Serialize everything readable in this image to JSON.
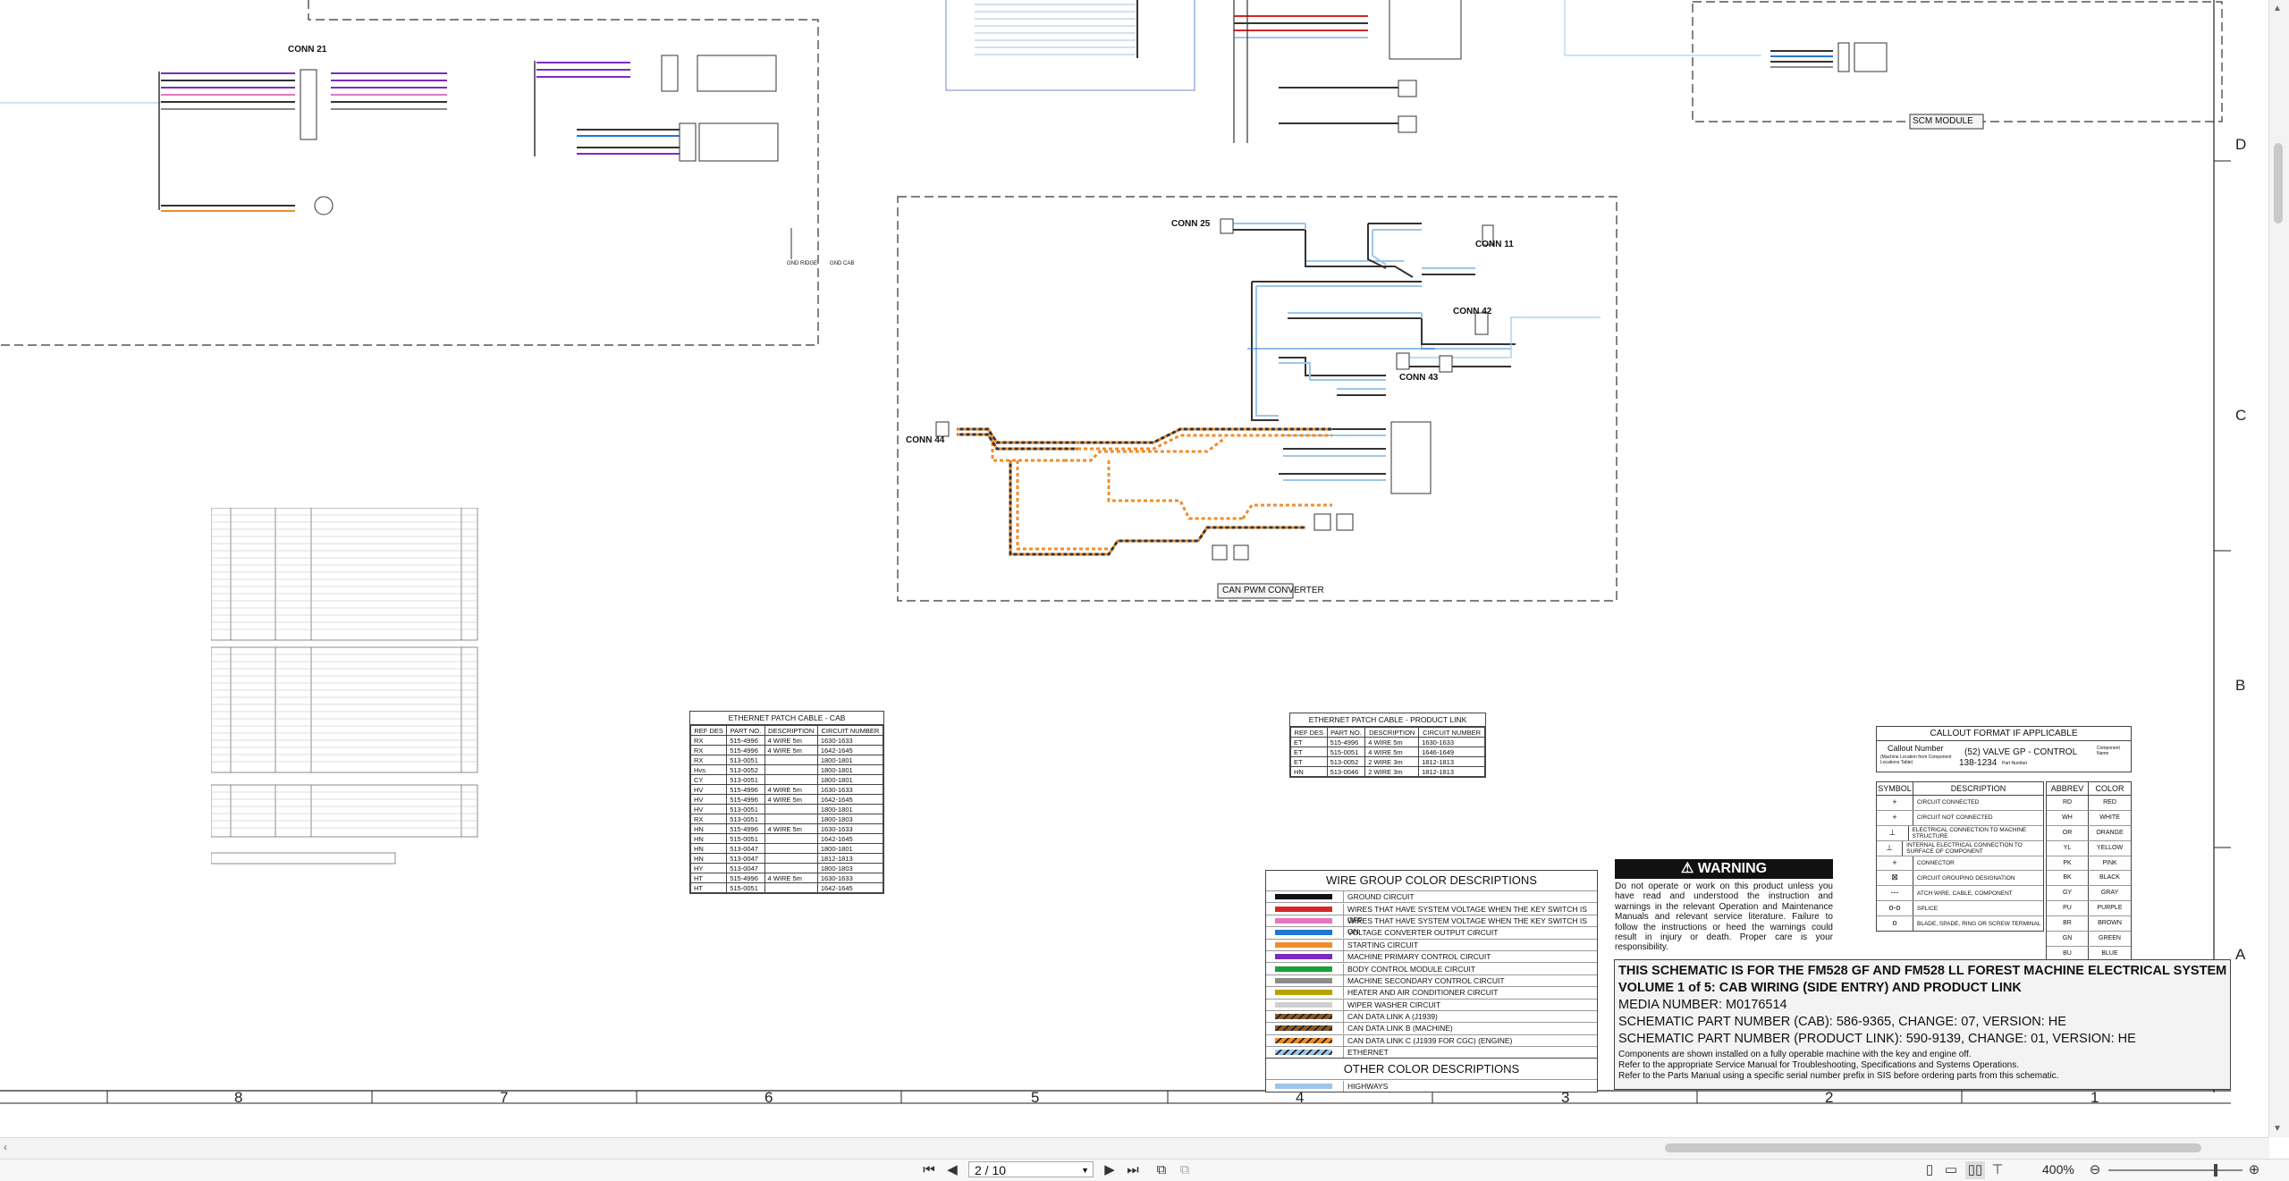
{
  "viewer": {
    "page_indicator": "2 / 10",
    "zoom": "400%"
  },
  "grid": {
    "columns": [
      "8",
      "7",
      "6",
      "5",
      "4",
      "3",
      "2",
      "1"
    ],
    "rows": [
      "D",
      "C",
      "B",
      "A"
    ]
  },
  "schematic": {
    "conn21": "CONN 21",
    "conn25": "CONN 25",
    "conn11": "CONN 11",
    "conn42": "CONN 42",
    "conn43": "CONN 43",
    "conn44": "CONN 44",
    "can_pwm_converter": "CAN PWM CONVERTER",
    "scm_module": "SCM MODULE",
    "gnd_ridge": "GND RIDGE",
    "gnd_cab": "GND CAB"
  },
  "ethernet_cab": {
    "title": "ETHERNET PATCH CABLE - CAB",
    "headers": [
      "REF DES",
      "PART NO.",
      "DESCRIPTION",
      "CIRCUIT NUMBER"
    ],
    "rows": [
      [
        "RX",
        "515-4996",
        "4 WIRE 5m",
        "1630-1633"
      ],
      [
        "RX",
        "515-4996",
        "4 WIRE 5m",
        "1642-1645"
      ],
      [
        "RX",
        "513-0051",
        "",
        "1800-1801"
      ],
      [
        "Hvs",
        "513-0052",
        "",
        "1800-1801"
      ],
      [
        "CY",
        "513-0051",
        "",
        "1800-1801"
      ],
      [
        "HV",
        "515-4996",
        "4 WIRE 5m",
        "1630-1633"
      ],
      [
        "HV",
        "515-4996",
        "4 WIRE 5m",
        "1642-1645"
      ],
      [
        "HV",
        "513-0051",
        "",
        "1800-1801"
      ],
      [
        "RX",
        "513-0051",
        "",
        "1800-1803"
      ],
      [
        "HN",
        "515-4996",
        "4 WIRE 5m",
        "1630-1633"
      ],
      [
        "HN",
        "515-0051",
        "",
        "1642-1645"
      ],
      [
        "HN",
        "513-0047",
        "",
        "1800-1801"
      ],
      [
        "HN",
        "513-0047",
        "",
        "1812-1813"
      ],
      [
        "HY",
        "513-0047",
        "",
        "1800-1803"
      ],
      [
        "HT",
        "515-4996",
        "4 WIRE 5m",
        "1630-1633"
      ],
      [
        "HT",
        "515-0051",
        "",
        "1642-1645"
      ]
    ]
  },
  "ethernet_product": {
    "title": "ETHERNET PATCH CABLE - PRODUCT LINK",
    "headers": [
      "REF DES",
      "PART NO.",
      "DESCRIPTION",
      "CIRCUIT NUMBER"
    ],
    "rows": [
      [
        "ET",
        "515-4996",
        "4 WIRE 5m",
        "1630-1633"
      ],
      [
        "ET",
        "515-0051",
        "4 WIRE 5m",
        "1646-1649"
      ],
      [
        "ET",
        "513-0052",
        "2 WIRE 3m",
        "1812-1813"
      ],
      [
        "HN",
        "513-0046",
        "2 WIRE 3m",
        "1812-1813"
      ]
    ]
  },
  "wire_groups": {
    "title": "WIRE GROUP COLOR DESCRIPTIONS",
    "items": [
      {
        "color": "#111111",
        "pattern": "solid",
        "label": "GROUND CIRCUIT"
      },
      {
        "color": "#d62728",
        "pattern": "solid",
        "label": "WIRES THAT HAVE SYSTEM VOLTAGE WHEN THE KEY SWITCH IS OFF"
      },
      {
        "color": "#e377c2",
        "pattern": "solid",
        "label": "WIRES THAT HAVE SYSTEM VOLTAGE WHEN THE KEY SWITCH IS ON"
      },
      {
        "color": "#1f77d4",
        "pattern": "solid",
        "label": "VOLTAGE CONVERTER OUTPUT CIRCUIT"
      },
      {
        "color": "#f28c28",
        "pattern": "solid",
        "label": "STARTING CIRCUIT"
      },
      {
        "color": "#7b2cbf",
        "pattern": "solid",
        "label": "MACHINE PRIMARY CONTROL CIRCUIT"
      },
      {
        "color": "#1a9e3a",
        "pattern": "solid",
        "label": "BODY CONTROL MODULE CIRCUIT"
      },
      {
        "color": "#8c8c8c",
        "pattern": "solid",
        "label": "MACHINE SECONDARY CONTROL CIRCUIT"
      },
      {
        "color": "#b5a300",
        "pattern": "solid",
        "label": "HEATER AND AIR CONDITIONER CIRCUIT"
      },
      {
        "color": "#cfcfcf",
        "pattern": "solid",
        "label": "WIPER WASHER CIRCUIT"
      },
      {
        "color": "#8a5a2b",
        "pattern": "hatch",
        "label": "CAN DATA LINK A (J1939)"
      },
      {
        "color": "#8a5a2b",
        "pattern": "hatch",
        "label": "CAN DATA LINK B (MACHINE)"
      },
      {
        "color": "#f28c28",
        "pattern": "hatch",
        "label": "CAN DATA LINK C (J1939 FOR CGC) (ENGINE)"
      },
      {
        "color": "#9ec6e8",
        "pattern": "hatch",
        "label": "ETHERNET"
      }
    ],
    "other_title": "OTHER COLOR DESCRIPTIONS",
    "other_items": [
      {
        "color": "#9ec6e8",
        "pattern": "solid",
        "label": "HIGHWAYS"
      }
    ]
  },
  "warning": {
    "title": "WARNING",
    "text": "Do not operate or work on this product unless you have read and understood the instruction and warnings in the relevant Operation and Maintenance Manuals and relevant service literature. Failure to follow the instructions or heed the warnings could result in injury or death. Proper care is your responsibility."
  },
  "callout": {
    "title": "CALLOUT FORMAT IF APPLICABLE",
    "callout_number": "Callout Number",
    "callout_sub": "(Machine Location from Component Locations Table)",
    "example": "(52) VALVE GP - CONTROL",
    "part_number": "138-1234",
    "component_name": "Component Name",
    "part_label": "Part Number"
  },
  "symbols": {
    "headers": [
      "SYMBOL",
      "DESCRIPTION"
    ],
    "rows": [
      {
        "sym": "+",
        "desc": "CIRCUIT CONNECTED"
      },
      {
        "sym": "+",
        "desc": "CIRCUIT NOT CONNECTED"
      },
      {
        "sym": "⊥",
        "desc": "ELECTRICAL CONNECTION TO MACHINE STRUCTURE"
      },
      {
        "sym": "⊥",
        "desc": "INTERNAL ELECTRICAL CONNECTION TO SURFACE OF COMPONENT"
      },
      {
        "sym": "+",
        "desc": "CONNECTOR"
      },
      {
        "sym": "⊠",
        "desc": "CIRCUIT GROUPING DESIGNATION"
      },
      {
        "sym": "---",
        "desc": "ATCH WIRE, CABLE, COMPONENT"
      },
      {
        "sym": "o-o",
        "desc": "SPLICE"
      },
      {
        "sym": "o",
        "desc": "BLADE, SPADE, RING OR SCREW TERMINAL"
      }
    ]
  },
  "abbrev": {
    "headers": [
      "ABBREV",
      "COLOR"
    ],
    "rows": [
      [
        "RD",
        "RED"
      ],
      [
        "WH",
        "WHITE"
      ],
      [
        "OR",
        "ORANGE"
      ],
      [
        "YL",
        "YELLOW"
      ],
      [
        "PK",
        "PINK"
      ],
      [
        "BK",
        "BLACK"
      ],
      [
        "GY",
        "GRAY"
      ],
      [
        "PU",
        "PURPLE"
      ],
      [
        "BR",
        "BROWN"
      ],
      [
        "GN",
        "GREEN"
      ],
      [
        "BU",
        "BLUE"
      ]
    ]
  },
  "title_block": {
    "line1": "THIS SCHEMATIC IS FOR THE FM528 GF AND FM528 LL FOREST MACHINE ELECTRICAL SYSTEM",
    "line2": "VOLUME 1 of 5: CAB WIRING (SIDE ENTRY) AND PRODUCT LINK",
    "line3": "MEDIA NUMBER: M0176514",
    "line4": "SCHEMATIC PART NUMBER (CAB): 586-9365, CHANGE: 07, VERSION: HE",
    "line5": "SCHEMATIC PART NUMBER (PRODUCT LINK): 590-9139, CHANGE: 01, VERSION: HE",
    "note1": "Components are shown installed on a fully operable machine with the key and engine off.",
    "note2": "Refer to the appropriate Service Manual for Troubleshooting, Specifications and Systems Operations.",
    "note3": "Refer to the Parts Manual using a specific serial number prefix in SIS before ordering parts from this schematic."
  }
}
